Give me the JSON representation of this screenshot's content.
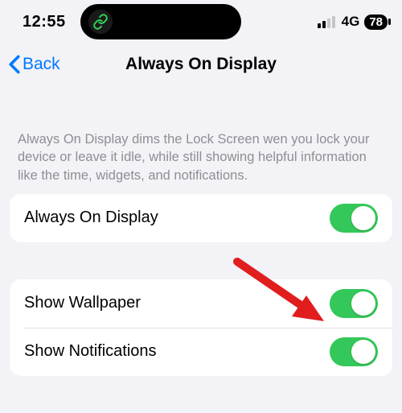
{
  "status": {
    "time": "12:55",
    "network_type": "4G",
    "battery": "78"
  },
  "nav": {
    "back_label": "Back",
    "title": "Always On Display"
  },
  "description": "Always On Display dims the Lock Screen wen you lock your device or leave it idle, while still showing helpful information like the time, widgets, and notifications.",
  "settings": {
    "always_on_display": {
      "label": "Always On Display",
      "enabled": true
    },
    "show_wallpaper": {
      "label": "Show Wallpaper",
      "enabled": true
    },
    "show_notifications": {
      "label": "Show Notifications",
      "enabled": true
    }
  },
  "colors": {
    "accent": "#007aff",
    "toggle_on": "#34c759",
    "secondary_text": "#8e8e93",
    "arrow": "#e11d1d"
  }
}
